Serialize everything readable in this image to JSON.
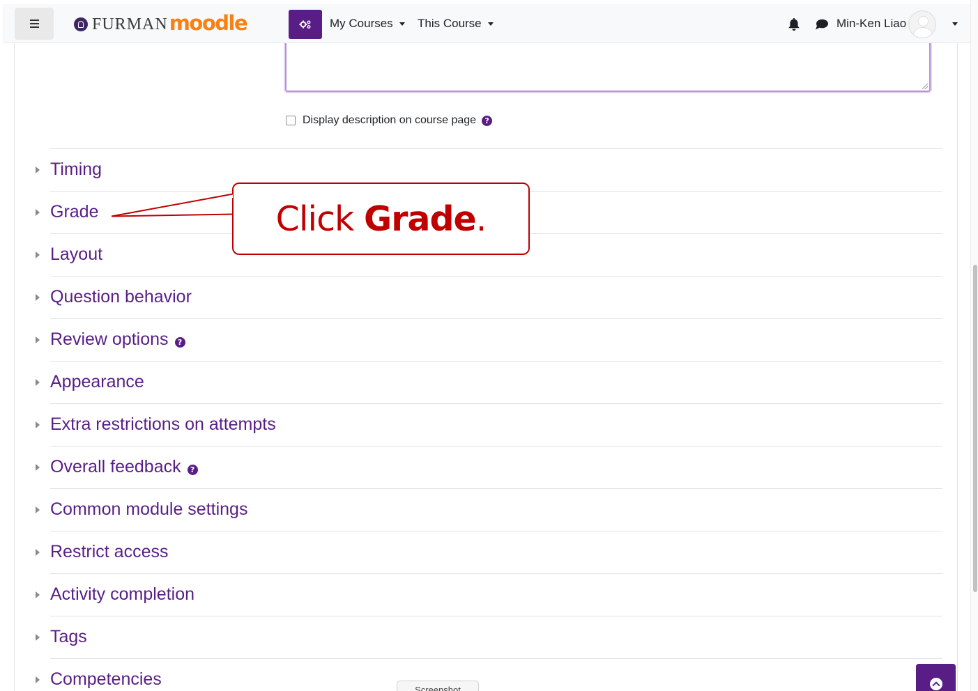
{
  "header": {
    "logo_text": "FURMAN",
    "logo_product": "moodle",
    "nav": {
      "my_courses": "My Courses",
      "this_course": "This Course"
    },
    "user_name": "Min-Ken Liao"
  },
  "form": {
    "display_description_label": "Display description on course page"
  },
  "sections": [
    {
      "label": "Timing",
      "help": false
    },
    {
      "label": "Grade",
      "help": false
    },
    {
      "label": "Layout",
      "help": false
    },
    {
      "label": "Question behavior",
      "help": false
    },
    {
      "label": "Review options",
      "help": true
    },
    {
      "label": "Appearance",
      "help": false
    },
    {
      "label": "Extra restrictions on attempts",
      "help": false
    },
    {
      "label": "Overall feedback",
      "help": true
    },
    {
      "label": "Common module settings",
      "help": false
    },
    {
      "label": "Restrict access",
      "help": false
    },
    {
      "label": "Activity completion",
      "help": false
    },
    {
      "label": "Tags",
      "help": false
    },
    {
      "label": "Competencies",
      "help": false
    }
  ],
  "callout": {
    "prefix": "Click ",
    "emphasis": "Grade",
    "suffix": "."
  },
  "footer": {
    "screenshot_tab": "Screenshot"
  },
  "colors": {
    "brand_purple": "#581e86",
    "callout_red": "#c00000",
    "moodle_orange": "#f98012"
  },
  "icons": {
    "menu": "hamburger-icon",
    "action_menu": "gears-icon",
    "notifications": "bell-icon",
    "messages": "chat-bubble-icon",
    "help": "question-circle-icon",
    "back_to_top": "arrow-up-circle-icon"
  }
}
